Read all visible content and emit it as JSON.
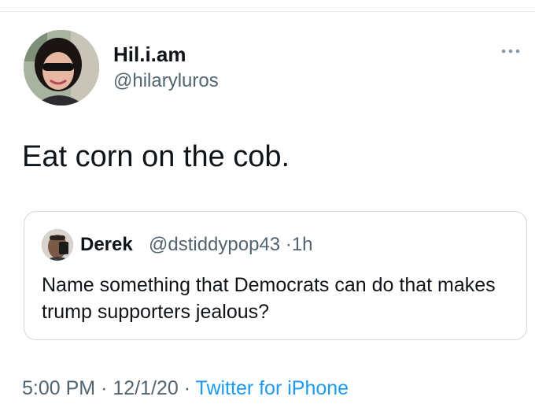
{
  "author": {
    "display_name": "Hil.i.am",
    "handle": "@hilaryluros"
  },
  "tweet": {
    "text": "Eat corn on the cob."
  },
  "quoted_tweet": {
    "display_name": "Derek",
    "handle": "@dstiddypop43",
    "separator": "·",
    "time_ago": "1h",
    "text": "Name something that Democrats can do that makes trump supporters jealous?"
  },
  "footer": {
    "time": "5:00 PM",
    "separator": "·",
    "date": "12/1/20",
    "source": "Twitter for iPhone"
  },
  "icons": {
    "more": "more-horizontal-icon"
  },
  "colors": {
    "link_blue": "#1d9bf0",
    "secondary_text": "#536471",
    "border": "#cfd9de"
  }
}
